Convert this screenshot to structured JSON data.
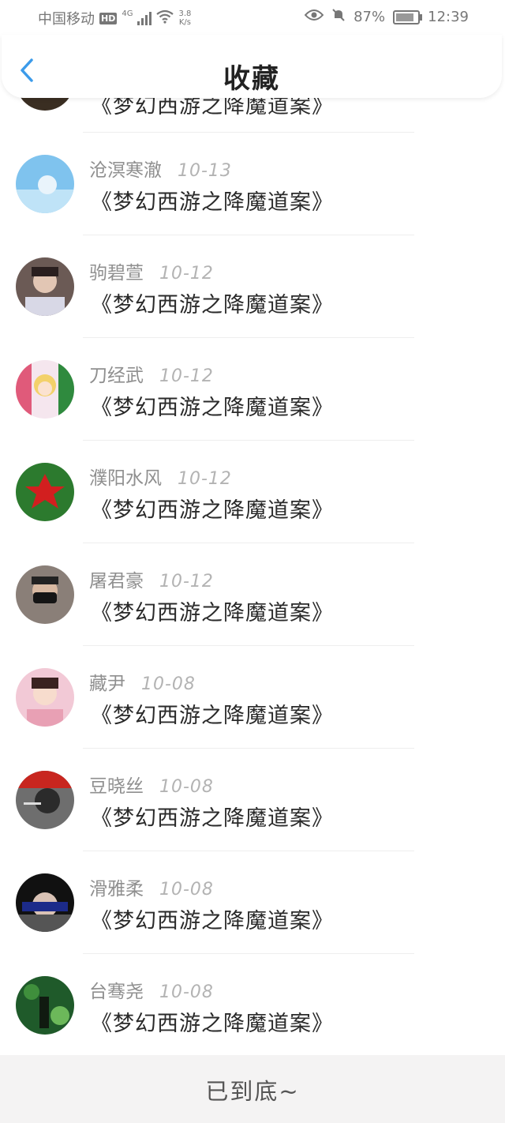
{
  "status_bar": {
    "carrier": "中国移动",
    "hd": "HD",
    "net_type": "4G",
    "speed_value": "3.8",
    "speed_unit": "K/s",
    "battery": "87%",
    "time": "12:39"
  },
  "header": {
    "title": "收藏"
  },
  "items": [
    {
      "name": "",
      "date": "",
      "title": "《梦幻西游之降魔道案》",
      "avatar_color": "#3a2e22"
    },
    {
      "name": "沧溟寒澈",
      "date": "10-13",
      "title": "《梦幻西游之降魔道案》",
      "avatar_color": "#5aa9e0"
    },
    {
      "name": "驹碧萱",
      "date": "10-12",
      "title": "《梦幻西游之降魔道案》",
      "avatar_color": "#6b5a55"
    },
    {
      "name": "刀经武",
      "date": "10-12",
      "title": "《梦幻西游之降魔道案》",
      "avatar_color": "#e96a8a"
    },
    {
      "name": "濮阳水风",
      "date": "10-12",
      "title": "《梦幻西游之降魔道案》",
      "avatar_color": "#2c7a2e"
    },
    {
      "name": "屠君豪",
      "date": "10-12",
      "title": "《梦幻西游之降魔道案》",
      "avatar_color": "#4a4040"
    },
    {
      "name": "藏尹",
      "date": "10-08",
      "title": "《梦幻西游之降魔道案》",
      "avatar_color": "#e8a0b4"
    },
    {
      "name": "豆晓丝",
      "date": "10-08",
      "title": "《梦幻西游之降魔道案》",
      "avatar_color": "#2a2a2a"
    },
    {
      "name": "滑雅柔",
      "date": "10-08",
      "title": "《梦幻西游之降魔道案》",
      "avatar_color": "#1b1b3a"
    },
    {
      "name": "台骞尧",
      "date": "10-08",
      "title": "《梦幻西游之降魔道案》",
      "avatar_color": "#1f5a2a"
    }
  ],
  "footer": {
    "end_text": "已到底~"
  }
}
